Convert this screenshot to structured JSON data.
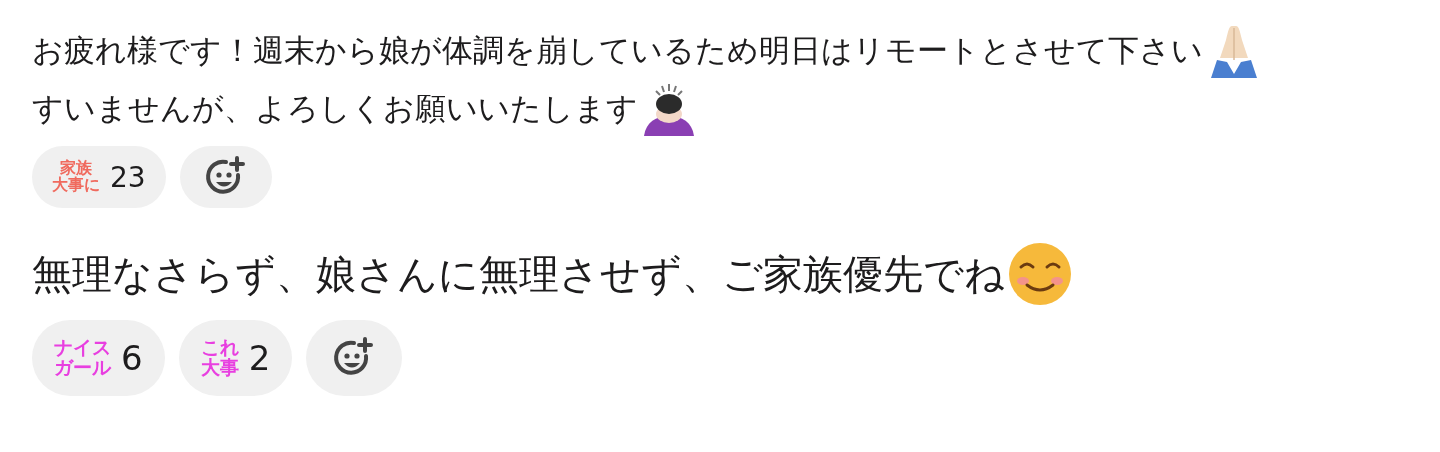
{
  "messages": [
    {
      "lines": [
        {
          "text": "お疲れ様です！週末から娘が体調を崩しているため明日はリモートとさせて下さい",
          "kind": "pray"
        },
        {
          "text": "すいませんが、よろしくお願いいたします",
          "kind": "bow"
        }
      ],
      "kind": "normal",
      "reactions": [
        {
          "kind": "stamp",
          "lines": [
            "家族",
            "大事に"
          ],
          "color": "#f06a5e",
          "count": "23"
        },
        {
          "kind": "add"
        }
      ]
    },
    {
      "lines": [
        {
          "text": "無理なさらず、娘さんに無理させず、ご家族優先でね",
          "kind": "smile"
        }
      ],
      "kind": "large",
      "reactions": [
        {
          "kind": "stamp",
          "lines": [
            "ナイス",
            "ガール"
          ],
          "color": "#e83fe0",
          "count": "6"
        },
        {
          "kind": "stamp",
          "lines": [
            "これ",
            "大事"
          ],
          "color": "#e83fe0",
          "count": "2"
        },
        {
          "kind": "add"
        }
      ]
    }
  ]
}
